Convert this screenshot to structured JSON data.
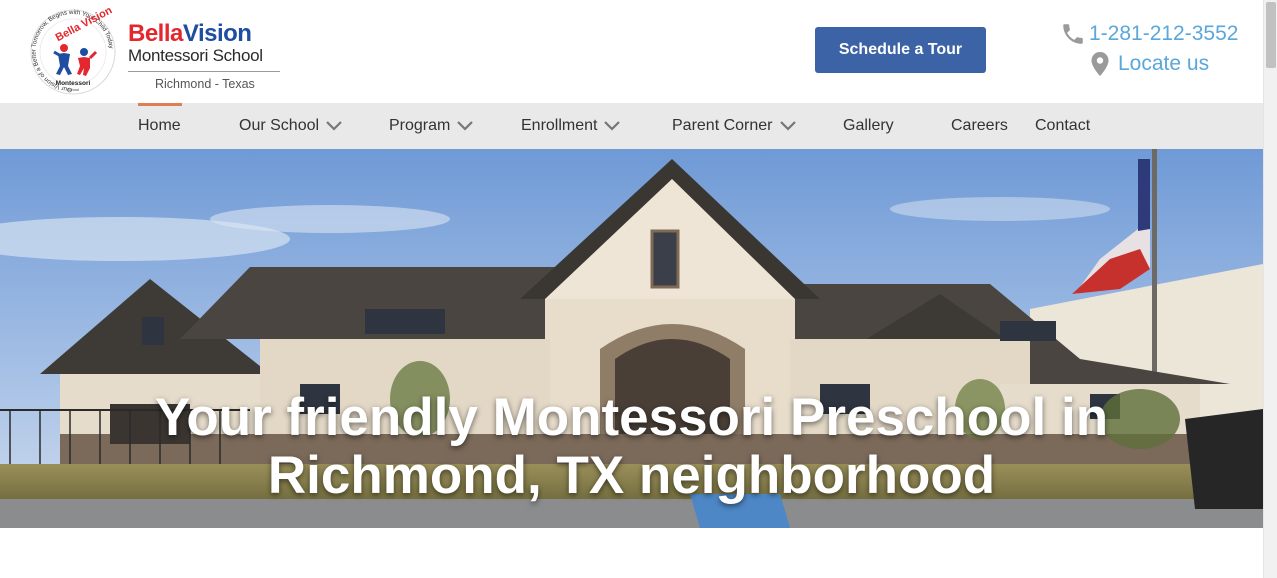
{
  "header": {
    "logo": {
      "ring_text": "Our Vision of a Better Tomorrow, Begins with Your Child Today",
      "badge_top": "Bella Vision",
      "badge_bottom": "Montessori",
      "badge_small": "School"
    },
    "brand": {
      "name_part1": "Bella",
      "name_part2": "Vision",
      "subtitle": "Montessori School",
      "location": "Richmond - Texas"
    },
    "cta_label": "Schedule a Tour",
    "phone": "1-281-212-3552",
    "locate_label": "Locate us",
    "icons": {
      "phone": "phone-icon",
      "locate": "map-pin-icon"
    },
    "colors": {
      "cta": "#3b63a5",
      "contact_text": "#5aa7dc",
      "brand_red": "#e4262d",
      "brand_blue": "#1e4da1",
      "nav_active": "#e07d57"
    }
  },
  "nav": {
    "items": [
      {
        "label": "Home",
        "dropdown": false,
        "active": true
      },
      {
        "label": "Our School",
        "dropdown": true,
        "active": false
      },
      {
        "label": "Program",
        "dropdown": true,
        "active": false
      },
      {
        "label": "Enrollment",
        "dropdown": true,
        "active": false
      },
      {
        "label": "Parent Corner",
        "dropdown": true,
        "active": false
      },
      {
        "label": "Gallery",
        "dropdown": false,
        "active": false
      },
      {
        "label": "Careers",
        "dropdown": false,
        "active": false
      },
      {
        "label": "Contact",
        "dropdown": false,
        "active": false
      }
    ]
  },
  "hero": {
    "title_line1": "Your friendly Montessori Preschool in",
    "title_line2": "Richmond, TX neighborhood"
  }
}
